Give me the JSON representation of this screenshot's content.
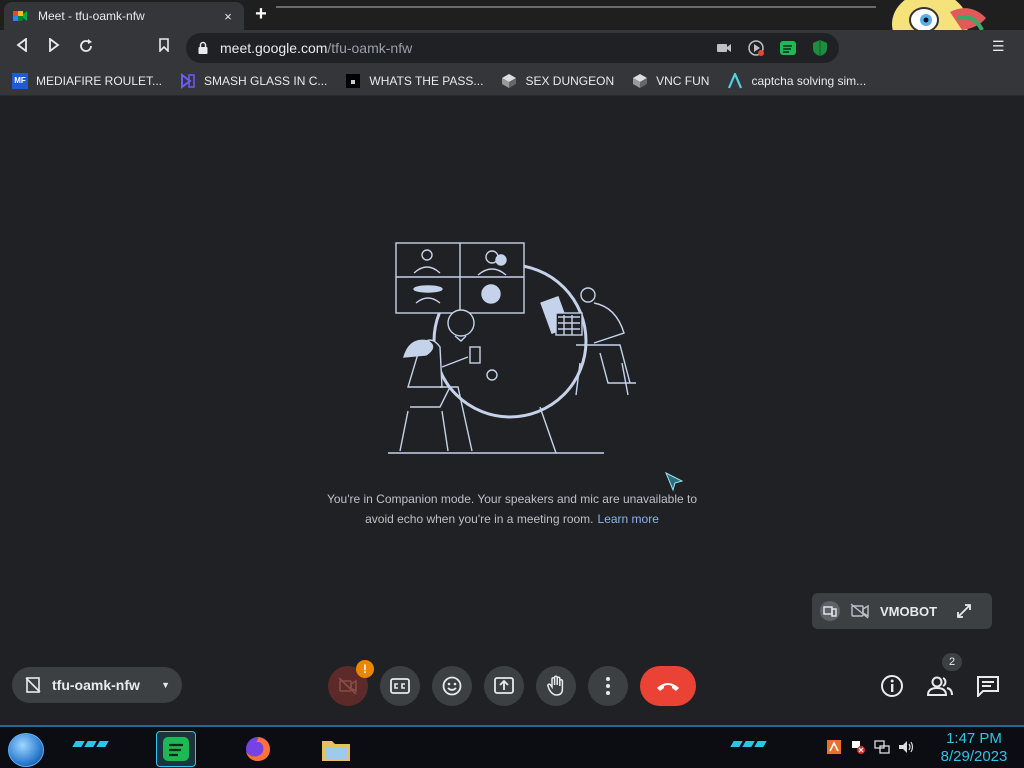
{
  "browser": {
    "tab_title": "Meet - tfu-oamk-nfw",
    "tab_close": "×",
    "new_tab": "+",
    "url_host": "meet.google.com",
    "url_path": "/tfu-oamk-nfw",
    "menu": "☰"
  },
  "bookmarks": [
    {
      "label": "MEDIAFIRE ROULET...",
      "icon": "mediafire-icon",
      "badge": "MF"
    },
    {
      "label": "SMASH GLASS IN C...",
      "icon": "glass-icon",
      "badge": ""
    },
    {
      "label": "WHATS THE PASS...",
      "icon": "lock-square-icon",
      "badge": ""
    },
    {
      "label": "SEX DUNGEON",
      "icon": "cube-icon",
      "badge": ""
    },
    {
      "label": "VNC FUN",
      "icon": "cube-icon",
      "badge": ""
    },
    {
      "label": "captcha solving sim...",
      "icon": "a-logo-icon",
      "badge": ""
    }
  ],
  "meet": {
    "companion_line1": "You're in Companion mode. Your speakers and mic are unavailable to",
    "companion_line2": "avoid echo when you're in a meeting room.",
    "learn_more": "Learn more",
    "self_name": "VMOBOT",
    "meeting_code": "tfu-oamk-nfw",
    "people_count": "2",
    "warning": "!"
  },
  "taskbar": {
    "time": "1:47 PM",
    "date": "8/29/2023"
  },
  "colors": {
    "accent_blue": "#8ab4f8",
    "hangup_red": "#ea4335",
    "taskbar_cyan": "#2bc6e6",
    "warning_orange": "#ea8600"
  }
}
